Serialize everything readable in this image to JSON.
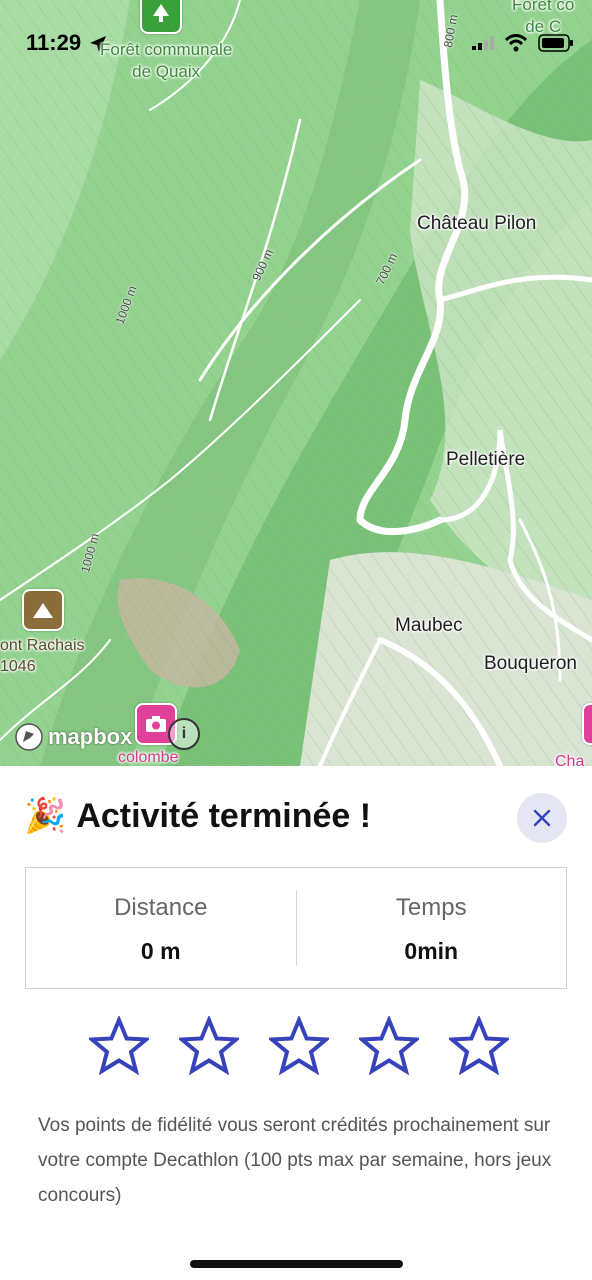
{
  "status_bar": {
    "time": "11:29"
  },
  "map": {
    "places": {
      "foret_quaix": "Forêt communale\nde Quaix",
      "foret_right": "Forêt co\nde C",
      "chateau_pilon": "Château Pilon",
      "pelletiere": "Pelletière",
      "maubec": "Maubec",
      "bouqueron": "Bouqueron",
      "mont_rachais": "ont Rachais\n1046",
      "colombe": "colombe",
      "cha": "Cha"
    },
    "contours": {
      "c800": "800 m",
      "c900": "900 m",
      "c700": "700 m",
      "c1000a": "1000 m",
      "c1000b": "1000 m"
    },
    "attribution": "mapbox",
    "info_symbol": "i"
  },
  "sheet": {
    "emoji": "🎉",
    "title": "Activité terminée !",
    "close_icon": "close-icon",
    "stats": [
      {
        "label": "Distance",
        "value": "0 m"
      },
      {
        "label": "Temps",
        "value": "0min"
      }
    ],
    "rating": {
      "max": 5,
      "value": 0
    },
    "message": "Vos points de fidélité vous seront crédités prochainement sur votre compte Decathlon (100 pts max par semaine, hors jeux concours)"
  },
  "colors": {
    "accent": "#3643ba",
    "close_bg": "#e4e6f3",
    "map_green": "#8fcf8c"
  }
}
